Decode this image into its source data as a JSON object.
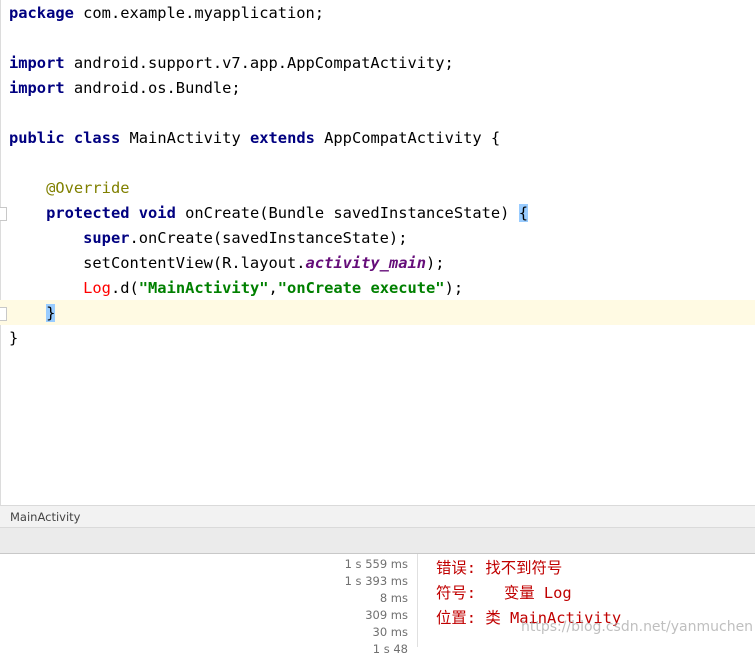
{
  "editor": {
    "line1": {
      "kw": "package",
      "rest": " com.example.myapplication;"
    },
    "line3": {
      "kw": "import",
      "rest": " android.support.v7.app.AppCompatActivity;"
    },
    "line4": {
      "kw": "import",
      "rest": " android.os.Bundle;"
    },
    "line6": {
      "kw1": "public",
      "kw2": "class",
      "name": "MainActivity",
      "kw3": "extends",
      "rest": " AppCompatActivity {"
    },
    "line8": {
      "annotation": "@Override"
    },
    "line9": {
      "kw1": "protected",
      "kw2": "void",
      "rest": " onCreate(Bundle savedInstanceState) ",
      "brace": "{"
    },
    "line10": {
      "kw": "super",
      "rest": ".onCreate(savedInstanceState);"
    },
    "line11": {
      "pre": "setContentView(R.layout.",
      "field": "activity_main",
      "post": ");"
    },
    "line12": {
      "cls": "Log",
      "pre": ".d(",
      "str1": "\"MainActivity\"",
      "comma": ",",
      "str2": "\"onCreate execute\"",
      "post": ");"
    },
    "line13": {
      "brace": "}"
    },
    "line14": {
      "brace": "}"
    }
  },
  "breadcrumb": {
    "label": "MainActivity"
  },
  "build": {
    "timings": [
      "1 s 559 ms",
      "1 s 393 ms",
      "8 ms",
      "309 ms",
      "30 ms",
      "1 s 48"
    ],
    "messages": [
      "错误: 找不到符号",
      "符号:   变量 Log",
      "位置: 类 MainActivity"
    ]
  },
  "watermark": "https://blog.csdn.net/yanmuchen"
}
